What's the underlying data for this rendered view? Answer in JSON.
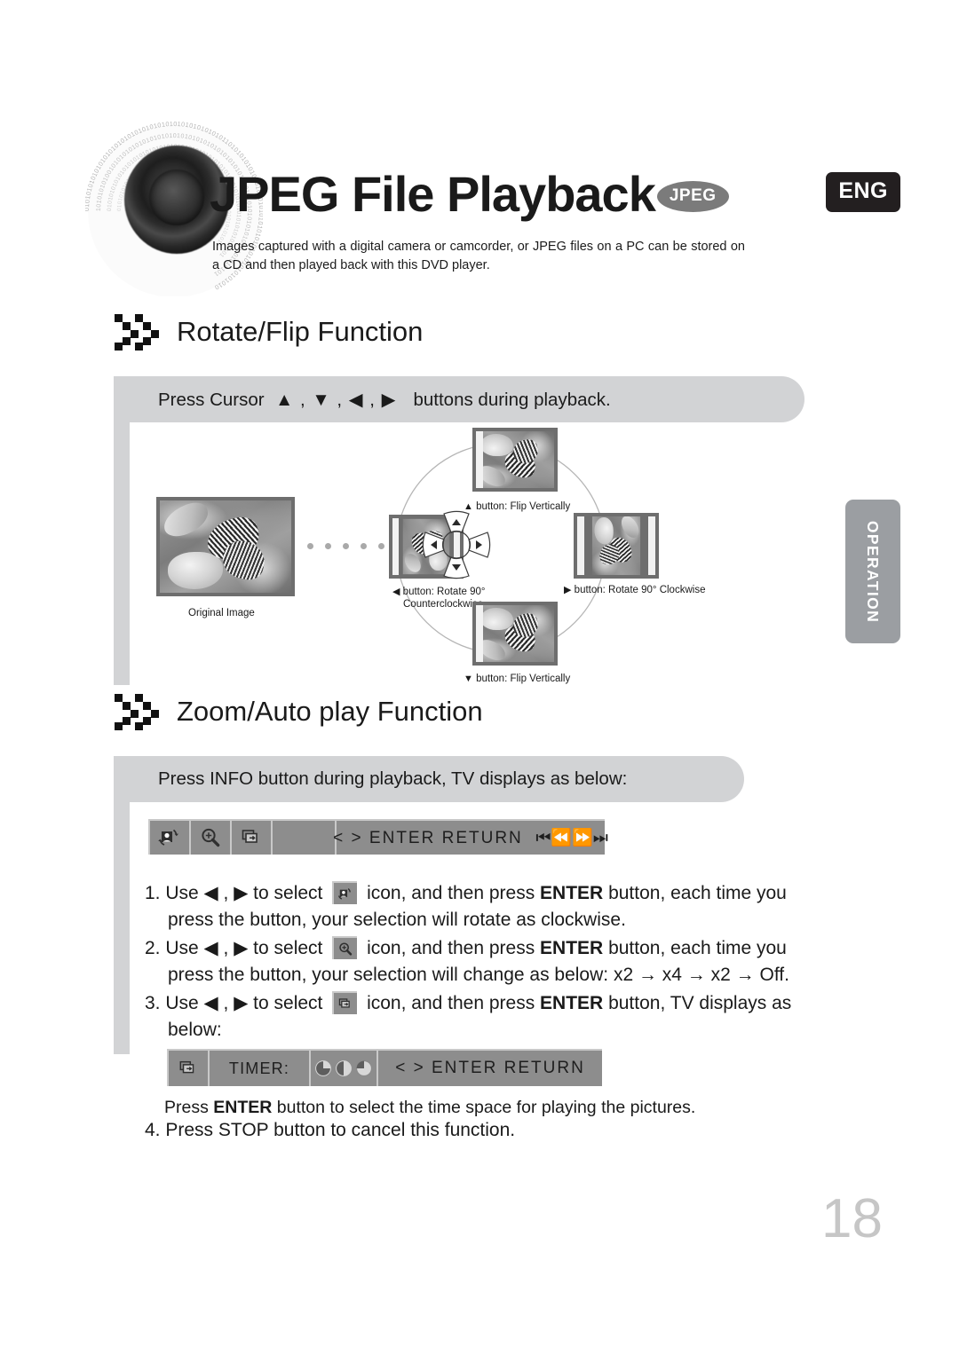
{
  "header": {
    "title": "JPEG File Playback",
    "format_badge": "JPEG",
    "language_badge": "ENG",
    "description": "Images captured with a digital camera or camcorder, or JPEG files on a PC can be stored on a CD and then played back with this DVD player.",
    "disc_icon": "speaker-disc-binary-icon"
  },
  "section1": {
    "heading": "Rotate/Flip Function",
    "bullet_icon": "pixel-chevron-icon",
    "callout": "Press Cursor ▲ , ▼ , ◀ , ▶  buttons during playback.",
    "callout_plain": "Press Cursor",
    "callout_tail": "buttons during playback.",
    "diagram": {
      "original_caption": "Original Image",
      "dpad_icon": "direction-pad-icon",
      "labels": [
        {
          "arrow": "▲",
          "text": "button: Flip Vertically",
          "position": "top"
        },
        {
          "arrow": "▶",
          "text": "button: Rotate 90° Clockwise",
          "position": "right"
        },
        {
          "arrow": "▼",
          "text": "button: Flip Vertically",
          "position": "bottom"
        },
        {
          "arrow": "◀",
          "text": "button: Rotate 90°",
          "text2": "Counterclockwise",
          "position": "left"
        }
      ]
    }
  },
  "section2": {
    "heading": "Zoom/Auto play Function",
    "bullet_icon": "pixel-chevron-icon",
    "callout": "Press INFO button during playback, TV displays as below:",
    "osd_bar": {
      "icons": [
        "rotate-icon",
        "zoom-in-icon",
        "slideshow-icon"
      ],
      "hint": "< > ENTER  RETURN",
      "transport": "⏮⏪⏩⏭"
    },
    "steps": [
      {
        "num": "1.",
        "lead": "Use ◀ ,  ▶ to select",
        "icon": "rotate-icon",
        "mid_a": "icon, and then press ",
        "bold": "ENTER",
        "mid_b": " button, each time you",
        "line2": "press the button, your selection will rotate as clockwise."
      },
      {
        "num": "2.",
        "lead": "Use ◀ ,  ▶ to select",
        "icon": "zoom-in-icon",
        "mid_a": "icon, and then press ",
        "bold": "ENTER",
        "mid_b": " button, each time you",
        "line2": "press the button, your selection will change as below: x2 → x4 → x2 → Off."
      },
      {
        "num": "3.",
        "lead": "Use ◀ ,  ▶ to select",
        "icon": "slideshow-icon",
        "mid_a": "icon, and then press ",
        "bold": "ENTER",
        "mid_b": " button, TV displays as",
        "line2": "below:"
      }
    ],
    "timer_bar": {
      "icon": "slideshow-icon",
      "label": "TIMER:",
      "pies": [
        "pie-quarter-icon",
        "pie-half-icon",
        "pie-three-quarter-icon"
      ],
      "hint": "< > ENTER  RETURN"
    },
    "timer_note_a": "Press ",
    "timer_note_bold": "ENTER",
    "timer_note_b": " button to select the time space for playing the pictures.",
    "step4": "4. Press STOP button to cancel this function."
  },
  "side_tab": {
    "label": "OPERATION"
  },
  "page_number": "18",
  "colors": {
    "callout_gray": "#d2d3d5",
    "osd_gray": "#8d8d8d",
    "tab_gray": "#9b9ea2",
    "badge_dark": "#231f20",
    "page_number_gray": "#c6c6c6"
  }
}
